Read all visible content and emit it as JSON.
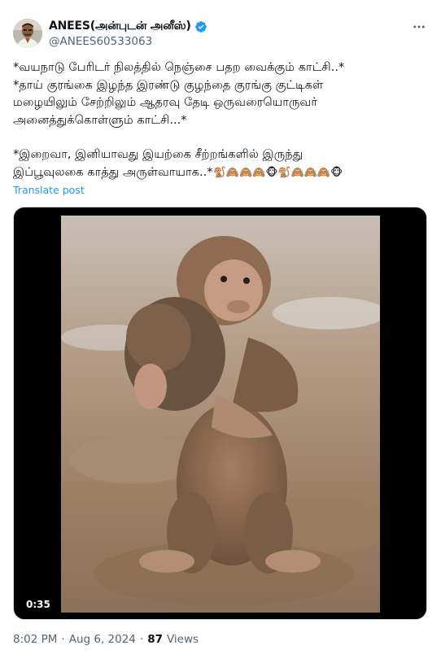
{
  "author": {
    "display_name": "ANEES(அன்புடன் அனீஸ்)",
    "handle": "@ANEES60533063",
    "verified": true
  },
  "tweet": {
    "lines": [
      "*வயநாடு பேரிடர் நிலத்தில் நெஞ்சை பதற வைக்கும் காட்சி..*",
      "*தாய் குரங்கை இழந்த இரண்டு குழந்தை குரங்கு குட்டிகள்",
      "மழையிலும் சேற்றிலும் ஆதரவு தேடி ஒருவரையொருவர்",
      "அனைத்துக்கொள்ளும் காட்சி...*",
      "*இறைவா, இனியாவது இயற்கை சீற்றங்களில் இருந்து",
      "இப்பூவுலகை காத்து அருள்வாயாக..*"
    ],
    "emojis": "🐒🙈🙈🙈🐵🐒🙈🙈🙈🐵",
    "translate_label": "Translate post"
  },
  "media": {
    "type": "video",
    "duration": "0:35"
  },
  "meta": {
    "time": "8:02 PM",
    "separator": "·",
    "date": "Aug 6, 2024",
    "views_count": "87",
    "views_label": "Views"
  },
  "colors": {
    "accent": "#1d9bf0",
    "text": "#0f1419",
    "secondary": "#536471"
  },
  "icons": {
    "verified": "verified-badge-icon",
    "more": "more-horizontal-icon"
  }
}
